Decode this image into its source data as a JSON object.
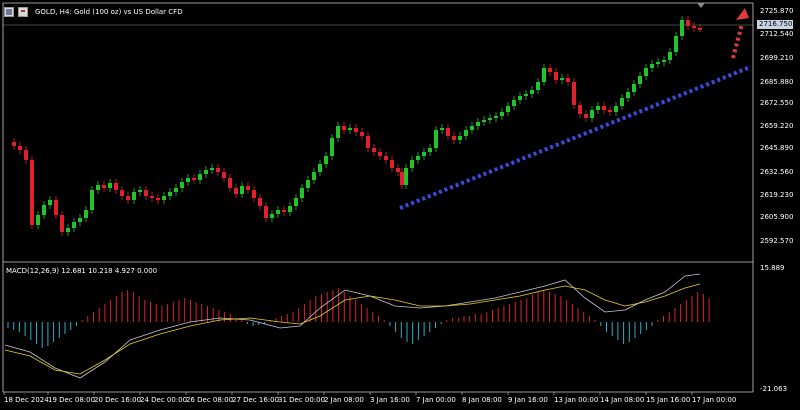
{
  "window": {
    "symbol_title": "GOLD, H4:  Gold (100 oz) vs US Dollar CFD"
  },
  "price_axis": [
    "2725.870",
    "2712.540",
    "2699.210",
    "2685.880",
    "2672.550",
    "2659.220",
    "2645.890",
    "2632.560",
    "2619.230",
    "2605.900",
    "2592.570"
  ],
  "current_price": "2716.750",
  "macd": {
    "label": "MACD(12,26,9) 12.681 10.218 4.927 0.000",
    "axis_top": "15.889",
    "axis_bottom": "-21.063"
  },
  "time_axis": [
    "18 Dec 2024",
    "19 Dec 08:00",
    "20 Dec 16:00",
    "24 Dec 00:00",
    "26 Dec 08:00",
    "27 Dec 16:00",
    "31 Dec 00:00",
    "2 Jan 08:00",
    "3 Jan 16:00",
    "7 Jan 00:00",
    "8 Jan 08:00",
    "9 Jan 16:00",
    "13 Jan 00:00",
    "14 Jan 08:00",
    "15 Jan 16:00",
    "17 Jan 00:00"
  ],
  "colors": {
    "bull": "#22c42a",
    "bear": "#e0202a",
    "trendline": "#3b4be0",
    "arrow": "#e03a3a",
    "macd_pos": "#e0202a",
    "macd_neg": "#2ab0c8",
    "macd_line": "#c8c8d8",
    "signal_line": "#e8d020"
  }
}
